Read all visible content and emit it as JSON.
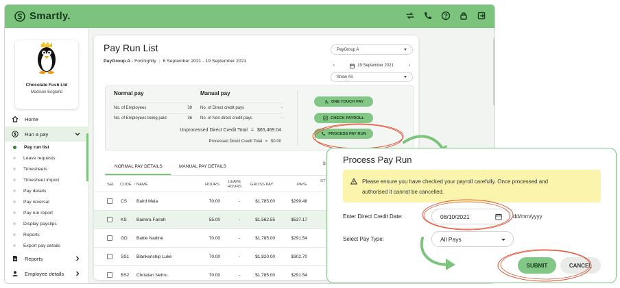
{
  "app": {
    "name": "Smartly."
  },
  "header_icons": [
    "swap-icon",
    "phone-icon",
    "help-icon",
    "lock-icon",
    "logout-icon"
  ],
  "company": {
    "name": "Chocolate Fush Ltd",
    "location": "Madison England"
  },
  "nav": {
    "home": "Home",
    "run_a_pay": "Run a pay",
    "sub": [
      "Pay run list",
      "Leave requests",
      "Timesheets",
      "Timesheet import",
      "Pay details",
      "Pay reversal",
      "Pay run report",
      "Display payslips",
      "Reports",
      "Export pay details"
    ],
    "reports": "Reports",
    "employee_details": "Employee details"
  },
  "page": {
    "title": "Pay Run List",
    "paygroup": "PayGroup A",
    "frequency": "- Fortnightly",
    "period": "6 September 2021 - 19 September 2021",
    "paygroup_select": "PayGroup A",
    "date": "19 September 2021",
    "show_select": "Show All"
  },
  "summary": {
    "normal_title": "Normal pay",
    "manual_title": "Manual pay",
    "normal_rows": [
      {
        "label": "No. of Employees",
        "value": "39"
      },
      {
        "label": "No. of Employees being paid",
        "value": "36"
      }
    ],
    "manual_rows": [
      {
        "label": "No. of Direct credit pays",
        "value": "-"
      },
      {
        "label": "No. of Non direct credit pays",
        "value": "-"
      }
    ],
    "unprocessed_label": "Unprocessed Direct Credit Total",
    "unprocessed_value": "$65,469.04",
    "processed_label": "Processed Direct Credit Total",
    "processed_value": "$0.00",
    "eq": "="
  },
  "actions": {
    "one_touch": "ONE TOUCH PAY",
    "check": "CHECK PAYROLL",
    "process": "PROCESS PAY RUN"
  },
  "tabs": {
    "normal": "NORMAL PAY DETAILS",
    "manual": "MANUAL PAY DETAILS",
    "extra": "$"
  },
  "table": {
    "headers": {
      "sel": "SEL",
      "code": "CODE",
      "name": "NAME",
      "hours": "HOURS",
      "leave1": "LEAVE",
      "leave2": "HOURS",
      "gross": "GROSS PAY",
      "paye": "PAYE",
      "st": "ST"
    },
    "rows": [
      {
        "code": "CS",
        "name": "Baird Maia",
        "hours": "70.00",
        "leave": "-",
        "gross": "$1,785.00",
        "paye": "$299.48"
      },
      {
        "code": "KS",
        "name": "Barrera Farrah",
        "hours": "55.00",
        "leave": "-",
        "gross": "$1,562.55",
        "paye": "$537.17"
      },
      {
        "code": "GD",
        "name": "Battle Nadine",
        "hours": "70.00",
        "leave": "-",
        "gross": "$1,785.00",
        "paye": "$291.54"
      },
      {
        "code": "SS1",
        "name": "Blankenship Luke",
        "hours": "70.00",
        "leave": "-",
        "gross": "$1,820.00",
        "paye": "$302.70"
      },
      {
        "code": "BS2",
        "name": "Christian Nehru",
        "hours": "70.00",
        "leave": "-",
        "gross": "$1,785.00",
        "paye": "$291.54"
      }
    ]
  },
  "modal": {
    "title": "Process Pay Run",
    "warning_line1": "Please ensure you have checked your payroll carefully. Once processed and",
    "warning_line2": "authorised it cannot be cancelled.",
    "date_label": "Enter Direct Credit Date:",
    "date_value": "08/10/2021",
    "date_hint": "dd/mm/yyyy",
    "type_label": "Select Pay Type:",
    "type_value": "All Pays",
    "submit": "SUBMIT",
    "cancel": "CANCEL"
  },
  "colors": {
    "brand_green": "#7cc47e",
    "button_green": "#82c785",
    "annotation_red": "#e2573a",
    "warning_bg": "#faf4ad"
  }
}
